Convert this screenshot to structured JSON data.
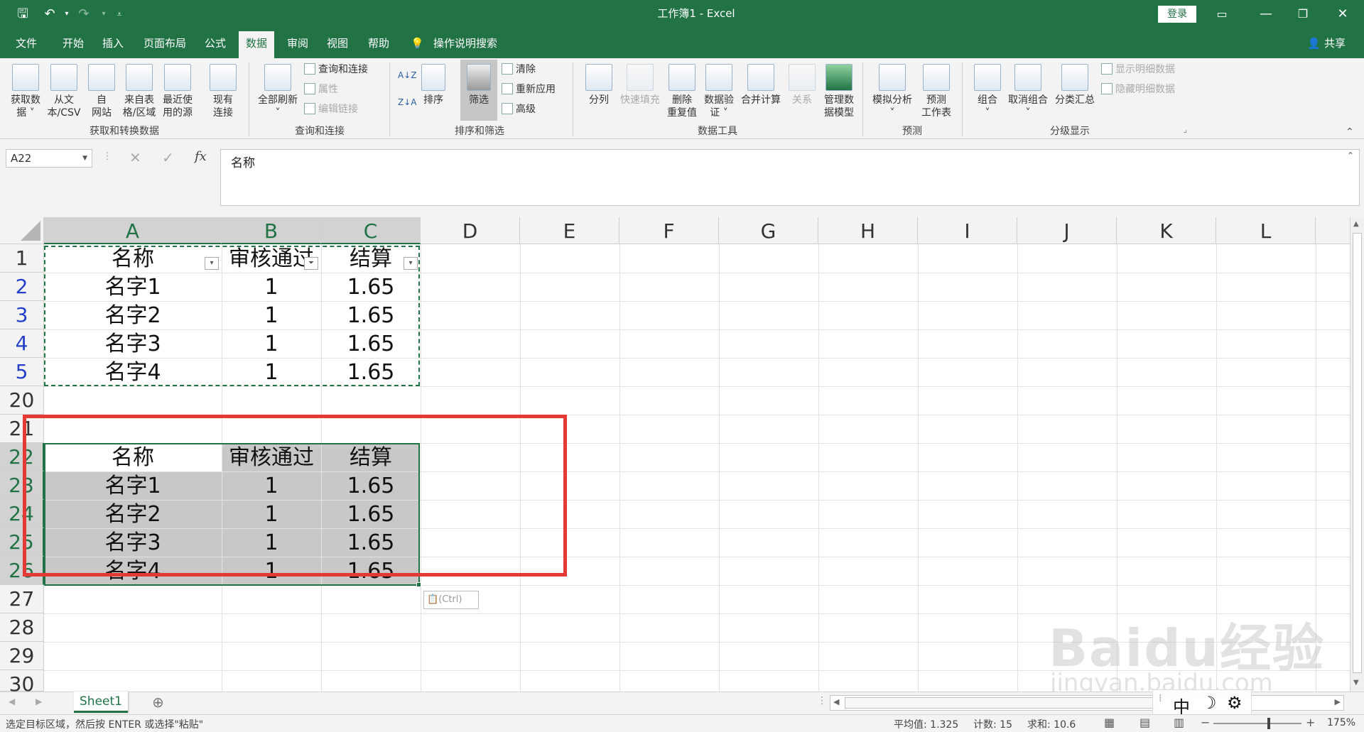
{
  "titlebar": {
    "title": "工作簿1  -  Excel",
    "login": "登录"
  },
  "tabs": [
    "文件",
    "开始",
    "插入",
    "页面布局",
    "公式",
    "数据",
    "审阅",
    "视图",
    "帮助"
  ],
  "active_tab": "数据",
  "tell_me": "操作说明搜索",
  "share": "共享",
  "ribbon": {
    "get_data": {
      "line1": "获取数",
      "line2": "据 ˅"
    },
    "from_csv": {
      "line1": "从文",
      "line2": "本/CSV"
    },
    "from_web": {
      "line1": "自",
      "line2": "网站"
    },
    "from_table": {
      "line1": "来自表",
      "line2": "格/区域"
    },
    "recent": {
      "line1": "最近使",
      "line2": "用的源"
    },
    "existing": {
      "line1": "现有",
      "line2": "连接"
    },
    "group1": "获取和转换数据",
    "refresh_all": {
      "line1": "全部刷新",
      "line2": "˅"
    },
    "queries": "查询和连接",
    "properties": "属性",
    "edit_links": "编辑链接",
    "group2": "查询和连接",
    "sort_az": "A↓Z",
    "sort_za": "Z↓A",
    "sort": "排序",
    "filter": "筛选",
    "clear": "清除",
    "reapply": "重新应用",
    "advanced": "高级",
    "group3": "排序和筛选",
    "text_to_col": "分列",
    "flash_fill": "快速填充",
    "remove_dup": {
      "line1": "删除",
      "line2": "重复值"
    },
    "validation": {
      "line1": "数据验",
      "line2": "证 ˅"
    },
    "consolidate": "合并计算",
    "relationships": "关系",
    "data_model": {
      "line1": "管理数",
      "line2": "据模型"
    },
    "group4": "数据工具",
    "what_if": {
      "line1": "模拟分析",
      "line2": "˅"
    },
    "forecast": {
      "line1": "预测",
      "line2": "工作表"
    },
    "group5": "预测",
    "group": {
      "line1": "组合",
      "line2": "˅"
    },
    "ungroup": {
      "line1": "取消组合",
      "line2": "˅"
    },
    "subtotal": "分类汇总",
    "show_detail": "显示明细数据",
    "hide_detail": "隐藏明细数据",
    "group6": "分级显示"
  },
  "formula_bar": {
    "name_box": "A22",
    "fx": "fx",
    "content": "名称"
  },
  "columns": [
    "A",
    "B",
    "C",
    "D",
    "E",
    "F",
    "G",
    "H",
    "I",
    "J",
    "K",
    "L"
  ],
  "rows": [
    "1",
    "2",
    "3",
    "4",
    "5",
    "20",
    "21",
    "22",
    "23",
    "24",
    "25",
    "26",
    "27",
    "28",
    "29",
    "30"
  ],
  "table_top": {
    "headers": [
      "名称",
      "审核通过",
      "结算"
    ],
    "rows": [
      [
        "名字1",
        "1",
        "1.65"
      ],
      [
        "名字2",
        "1",
        "1.65"
      ],
      [
        "名字3",
        "1",
        "1.65"
      ],
      [
        "名字4",
        "1",
        "1.65"
      ]
    ]
  },
  "table_bottom": {
    "headers": [
      "名称",
      "审核通过",
      "结算"
    ],
    "rows": [
      [
        "名字1",
        "1",
        "1.65"
      ],
      [
        "名字2",
        "1",
        "1.65"
      ],
      [
        "名字3",
        "1",
        "1.65"
      ],
      [
        "名字4",
        "1",
        "1.65"
      ]
    ]
  },
  "paste_options": "(Ctrl)",
  "sheet_tab": "Sheet1",
  "ime": {
    "lang": "中",
    "moon": "☽",
    "gear": "⚙"
  },
  "status": {
    "message": "选定目标区域，然后按 ENTER 或选择\"粘贴\"",
    "average": "平均值: 1.325",
    "count": "计数: 15",
    "sum": "求和: 10.6",
    "zoom": "175%"
  },
  "watermark": {
    "text": "Baidu经验",
    "url": "jingyan.baidu.com"
  },
  "colors": {
    "excel_green": "#217346",
    "highlight": "#e53935"
  }
}
